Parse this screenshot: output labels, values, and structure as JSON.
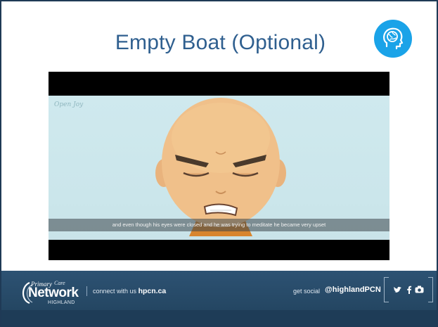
{
  "slide": {
    "title": "Empty Boat (Optional)",
    "icon": "brain-head-icon",
    "accent_color": "#1aa3e8",
    "title_color": "#2f5f8f"
  },
  "video": {
    "watermark": "Open Joy",
    "subtitle": "and even though his eyes were closed and he was trying to meditate he became very upset"
  },
  "footer": {
    "logo": {
      "primary": "Primary",
      "care": "Care",
      "network": "Network",
      "highland": "HIGHLAND"
    },
    "connect_prefix": "connect with us",
    "connect_site": "hpcn.ca",
    "social_prefix": "get social",
    "social_handle": "@highlandPCN",
    "social_icons": [
      "twitter-icon",
      "facebook-icon",
      "youtube-icon"
    ],
    "background_color": "#2a4b68"
  }
}
